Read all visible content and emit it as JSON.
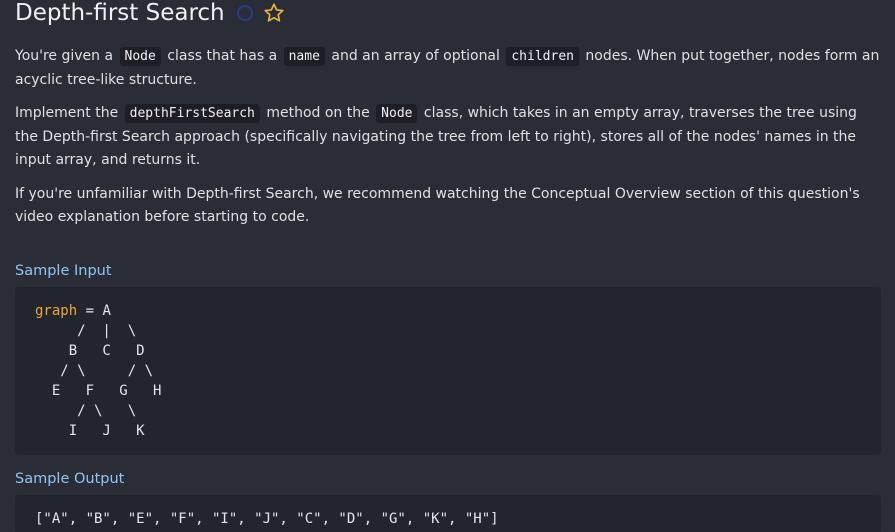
{
  "header": {
    "title": "Depth-first Search"
  },
  "description": {
    "p1": {
      "t1": "You're given a ",
      "c1": "Node",
      "t2": " class that has a ",
      "c2": "name",
      "t3": " and an array of optional ",
      "c3": "children",
      "t4": " nodes. When put together, nodes form an acyclic tree-like structure."
    },
    "p2": {
      "t1": "Implement the ",
      "c1": "depthFirstSearch",
      "t2": " method on the ",
      "c2": "Node",
      "t3": " class, which takes in an empty array, traverses the tree using the Depth-first Search approach (specifically navigating the tree from left to right), stores all of the nodes' names in the input array, and returns it."
    },
    "p3": {
      "t1": "If you're unfamiliar with Depth-first Search, we recommend watching the Conceptual Overview section of this question's video explanation before starting to code."
    }
  },
  "sample_input": {
    "heading": "Sample Input",
    "variable": "graph",
    "code": " = A\n     /  |  \\\n    B   C   D\n   / \\     / \\\n  E   F   G   H\n     / \\   \\\n    I   J   K"
  },
  "sample_output": {
    "heading": "Sample Output",
    "code": "[\"A\", \"B\", \"E\", \"F\", \"I\", \"J\", \"C\", \"D\", \"G\", \"K\", \"H\"]"
  },
  "colors": {
    "background": "#2b2d36",
    "heading_accent": "#8fc6f0",
    "keyword": "#e8a73a",
    "status_circle": "#283a8a",
    "star": "#e8b53a"
  },
  "icons": {
    "status": "status-circle-icon",
    "favorite": "star-icon"
  }
}
